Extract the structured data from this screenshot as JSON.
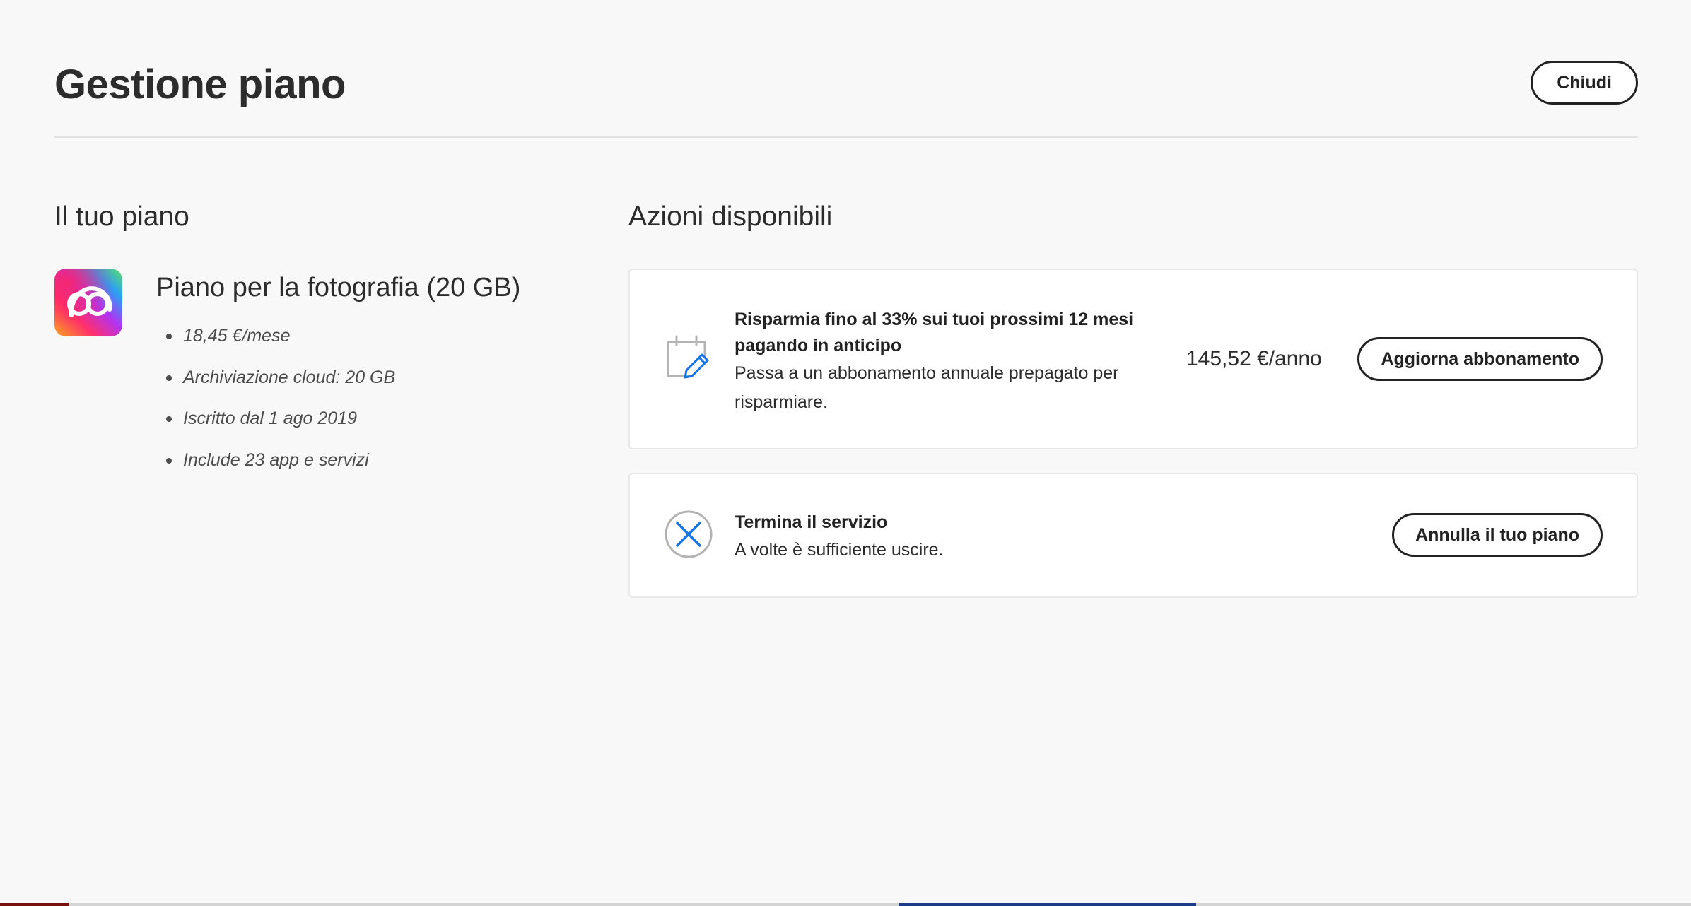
{
  "header": {
    "title": "Gestione piano",
    "close_label": "Chiudi"
  },
  "plan": {
    "heading": "Il tuo piano",
    "icon": "creative-cloud-icon",
    "name": "Piano per la fotografia (20 GB)",
    "details": [
      "18,45 €/mese",
      "Archiviazione cloud: 20 GB",
      "Iscritto dal 1 ago 2019",
      "Include 23 app e servizi"
    ]
  },
  "actions": {
    "heading": "Azioni disponibili",
    "upgrade": {
      "icon": "calendar-edit-icon",
      "title": "Risparmia fino al 33% sui tuoi prossimi 12 mesi pagando in anticipo",
      "description": "Passa a un abbonamento annuale prepagato per risparmiare.",
      "price": "145,52 €/anno",
      "button_label": "Aggiorna abbonamento"
    },
    "cancel": {
      "icon": "close-circle-icon",
      "title": "Termina il servizio",
      "description": "A volte è sufficiente uscire.",
      "button_label": "Annulla il tuo piano"
    }
  },
  "colors": {
    "background": "#f8f8f8",
    "card_background": "#ffffff",
    "text_primary": "#2c2c2c",
    "accent_blue": "#1473e6",
    "icon_gray": "#b3b3b3",
    "button_border": "#222222"
  }
}
